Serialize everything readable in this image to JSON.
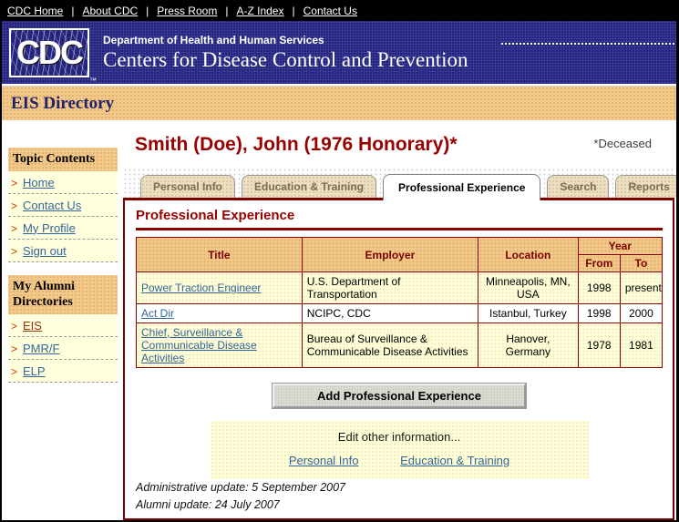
{
  "top_nav": {
    "separator": "|",
    "links": [
      "CDC Home",
      "About CDC",
      "Press Room",
      "A-Z Index",
      "Contact Us"
    ]
  },
  "header": {
    "logo_text": "CDC",
    "logo_tm": "™",
    "dept": "Department of Health and Human Services",
    "org": "Centers for Disease Control and Prevention"
  },
  "banner": {
    "title": "EIS Directory"
  },
  "sidebar": {
    "arrow": ">",
    "sections": [
      {
        "title": "Topic Contents",
        "items": [
          {
            "label": "Home"
          },
          {
            "label": "Contact Us"
          },
          {
            "label": "My Profile"
          },
          {
            "label": "Sign out"
          }
        ]
      },
      {
        "title": "My Alumni Directories",
        "items": [
          {
            "label": "EIS",
            "current": true
          },
          {
            "label": "PMR/F"
          },
          {
            "label": "ELP"
          }
        ]
      }
    ]
  },
  "main": {
    "title": "Smith (Doe), John (1976 Honorary)*",
    "deceased_note": "*Deceased",
    "tabs": [
      {
        "label": "Personal Info",
        "active": false
      },
      {
        "label": "Education & Training",
        "active": false
      },
      {
        "label": "Professional Experience",
        "active": true
      },
      {
        "label": "Search",
        "active": false
      },
      {
        "label": "Reports",
        "active": false
      }
    ],
    "section_heading": "Professional Experience",
    "table": {
      "headers": {
        "title": "Title",
        "employer": "Employer",
        "location": "Location",
        "year": "Year",
        "from": "From",
        "to": "To"
      },
      "rows": [
        {
          "title": "Power Traction Engineer",
          "employer": "U.S. Department of Transportation",
          "location": "Minneapolis, MN, USA",
          "from": "1998",
          "to": "present"
        },
        {
          "title": "Act Dir",
          "employer": "NCIPC, CDC",
          "location": "Istanbul, Turkey",
          "from": "1998",
          "to": "2000"
        },
        {
          "title": "Chief, Surveillance & Communicable Disease Activities",
          "employer": "Bureau of Surveillance & Communicable Disease Activities",
          "location": "Hanover, Germany",
          "from": "1978",
          "to": "1981"
        }
      ]
    },
    "add_button": "Add Professional Experience",
    "edit_box": {
      "heading": "Edit other information...",
      "links": [
        "Personal Info",
        "Education & Training"
      ]
    },
    "footer": {
      "admin_update": "Administrative update: 5 September 2007",
      "alumni_update": "Alumni update: 24 July 2007"
    }
  },
  "colors": {
    "navy_header": "#24247D",
    "tan_accent": "#F2C98C",
    "pale_yellow": "#FFFFD9",
    "maroon_accent": "#8B0000",
    "link_blue": "#336699",
    "arrow_red": "#CC3300"
  }
}
